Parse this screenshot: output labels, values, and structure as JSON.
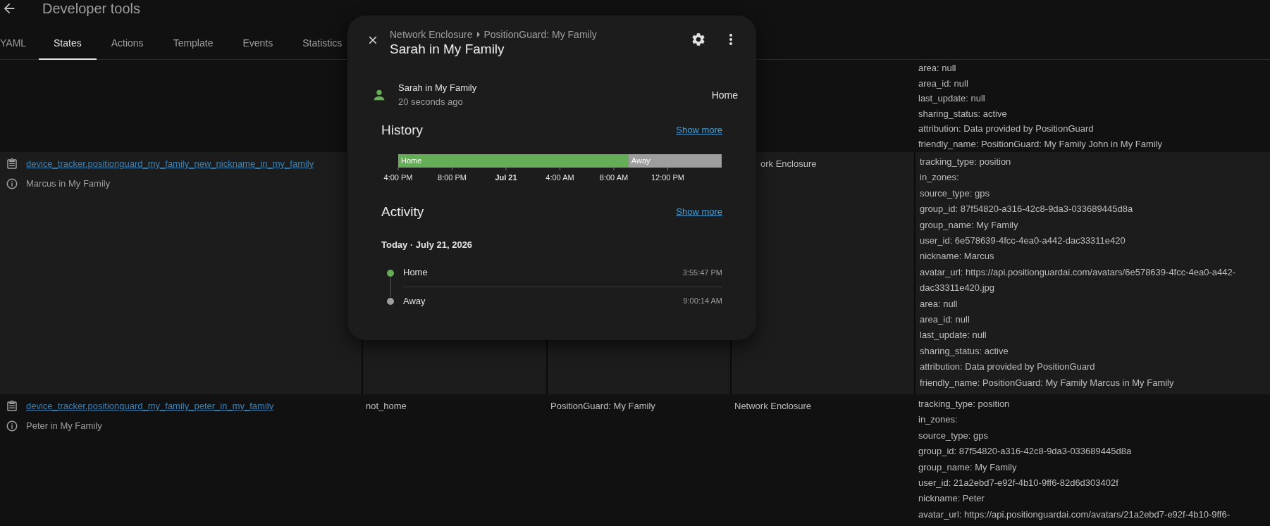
{
  "header": {
    "title": "Developer tools"
  },
  "tabs": [
    {
      "label": "YAML",
      "selected": false
    },
    {
      "label": "States",
      "selected": true
    },
    {
      "label": "Actions",
      "selected": false
    },
    {
      "label": "Template",
      "selected": false
    },
    {
      "label": "Events",
      "selected": false
    },
    {
      "label": "Statistics",
      "selected": false
    }
  ],
  "table": {
    "rows": [
      {
        "attributes": [
          "area: null",
          "area_id: null",
          "last_update: null",
          "sharing_status: active",
          "attribution: Data provided by PositionGuard",
          "friendly_name: PositionGuard: My Family John in My Family"
        ]
      },
      {
        "entity_id": "device_tracker.positionguard_my_family_new_nickname_in_my_family",
        "friendly_name": "Marcus in My Family",
        "column_4": "ork Enclosure",
        "attributes": [
          "tracking_type: position",
          "in_zones:",
          "source_type: gps",
          "group_id: 87f54820-a316-42c8-9da3-033689445d8a",
          "group_name: My Family",
          "user_id: 6e578639-4fcc-4ea0-a442-dac33311e420",
          "nickname: Marcus",
          "avatar_url: https://api.positionguardai.com/avatars/6e578639-4fcc-4ea0-a442-dac33311e420.jpg",
          "area: null",
          "area_id: null",
          "last_update: null",
          "sharing_status: active",
          "attribution: Data provided by PositionGuard",
          "friendly_name: PositionGuard: My Family Marcus in My Family"
        ]
      },
      {
        "entity_id": "device_tracker.positionguard_my_family_peter_in_my_family",
        "friendly_name": "Peter in My Family",
        "state": "not_home",
        "column_3": "PositionGuard: My Family",
        "column_4": "Network Enclosure",
        "attributes": [
          "tracking_type: position",
          "in_zones:",
          "source_type: gps",
          "group_id: 87f54820-a316-42c8-9da3-033689445d8a",
          "group_name: My Family",
          "user_id: 21a2ebd7-e92f-4b10-9ff6-82d6d303402f",
          "nickname: Peter",
          "avatar_url: https://api.positionguardai.com/avatars/21a2ebd7-e92f-4b10-9ff6-"
        ]
      }
    ]
  },
  "dialog": {
    "breadcrumb": [
      "Network Enclosure",
      "PositionGuard: My Family"
    ],
    "title": "Sarah in My Family",
    "entity": {
      "name": "Sarah in My Family",
      "last_changed": "20 seconds ago",
      "state": "Home",
      "color": "#66ad57"
    },
    "history": {
      "heading": "History",
      "show_more": "Show more",
      "timeline": {
        "level": 0.712,
        "segments": [
          {
            "label": "Home",
            "color": "#66ad57"
          },
          {
            "label": "Away",
            "color": "#9e9e9e"
          }
        ],
        "axis_labels": [
          {
            "label": "4:00 PM",
            "bold": false
          },
          {
            "label": "8:00 PM",
            "bold": false
          },
          {
            "label": "Jul 21",
            "bold": true
          },
          {
            "label": "4:00 AM",
            "bold": false
          },
          {
            "label": "8:00 AM",
            "bold": false
          },
          {
            "label": "12:00 PM",
            "bold": false
          }
        ]
      }
    },
    "activity": {
      "heading": "Activity",
      "show_more": "Show more",
      "date": "Today · July 21, 2026",
      "entries": [
        {
          "state": "Home",
          "time": "3:55:47 PM",
          "color": "#66ad57"
        },
        {
          "state": "Away",
          "time": "9:00:14 AM",
          "color": "#9e9e9e"
        }
      ]
    }
  }
}
